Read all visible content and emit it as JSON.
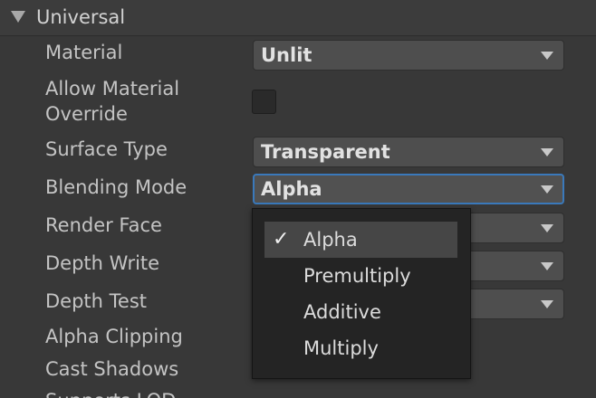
{
  "section": {
    "title": "Universal"
  },
  "fields": {
    "material": {
      "label": "Material",
      "value": "Unlit"
    },
    "allow_override": {
      "label_line1": "Allow Material",
      "label_line2": "Override",
      "checked": false
    },
    "surface_type": {
      "label": "Surface Type",
      "value": "Transparent"
    },
    "blending_mode": {
      "label": "Blending Mode",
      "value": "Alpha"
    },
    "render_face": {
      "label": "Render Face"
    },
    "depth_write": {
      "label": "Depth Write"
    },
    "depth_test": {
      "label": "Depth Test"
    },
    "alpha_clipping": {
      "label": "Alpha Clipping"
    },
    "cast_shadows": {
      "label": "Cast Shadows"
    },
    "supports_lod": {
      "label": "Supports LOD"
    }
  },
  "blending_menu": {
    "selected": "Alpha",
    "check_glyph": "✓",
    "options": [
      "Alpha",
      "Premultiply",
      "Additive",
      "Multiply"
    ]
  },
  "colors": {
    "background": "#383838",
    "focus_accent": "#3a79bb",
    "popup_background": "#242424"
  }
}
